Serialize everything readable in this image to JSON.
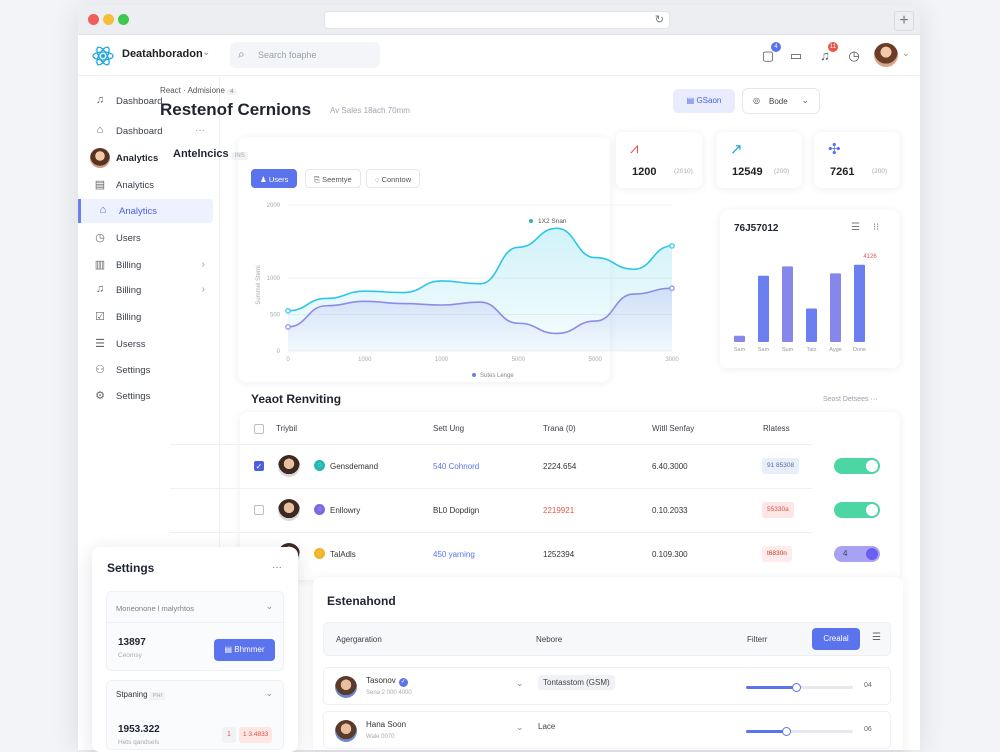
{
  "app": {
    "brand": "Deatahboradon",
    "search_placeholder": "Search foaphe",
    "notifications": {
      "tasks": "4",
      "alerts": "11"
    }
  },
  "sidebar": {
    "items": [
      {
        "label": "Dashboard",
        "icon": "bell-icon",
        "chevron": ""
      },
      {
        "label": "Dashboard",
        "icon": "home-icon",
        "chevron": "···"
      },
      {
        "label": "Analytics",
        "icon": "avatar",
        "chevron": ""
      },
      {
        "label": "Analytics",
        "icon": "window-icon",
        "chevron": ""
      },
      {
        "label": "Analytics",
        "icon": "home-icon",
        "chevron": ""
      },
      {
        "label": "Users",
        "icon": "clock-icon",
        "chevron": ""
      },
      {
        "label": "Billing",
        "icon": "document-icon",
        "chevron": "›"
      },
      {
        "label": "Billing",
        "icon": "bell-icon",
        "chevron": "›"
      },
      {
        "label": "Billing",
        "icon": "checklist-icon",
        "chevron": ""
      },
      {
        "label": "Userss",
        "icon": "list-icon",
        "chevron": ""
      },
      {
        "label": "Settings",
        "icon": "users-gear-icon",
        "chevron": ""
      },
      {
        "label": "Settings",
        "icon": "gear-icon",
        "chevron": ""
      }
    ],
    "active_index": 4
  },
  "header": {
    "breadcrumb": "React  ·  Admisione",
    "breadcrumb_badge": "4",
    "title": "Restenof Cernions",
    "subtitle": "Av  Sales  18ach 70mm",
    "primary_button": "GSaon",
    "select_button": "Bode"
  },
  "analytics": {
    "title": "Antelncics",
    "title_badge": "INS",
    "chips": [
      "Users",
      "Seemtye",
      "Conntow"
    ],
    "active_chip": 0
  },
  "chart_data": {
    "type": "area",
    "x_ticks": [
      "0",
      "1000",
      "1000",
      "5000",
      "5000",
      "3000"
    ],
    "y_ticks": [
      "0",
      "500",
      "1000",
      "2000"
    ],
    "ylabel": "Summel Sterni",
    "legend_top": "1X2 Snan",
    "legend_bottom": "Sutes Lenge",
    "ylim": [
      0,
      2000
    ],
    "series": [
      {
        "color": "#2cc6e6",
        "values": [
          550,
          720,
          820,
          800,
          960,
          920,
          1420,
          1680,
          1280,
          1120,
          1440
        ]
      },
      {
        "color": "#8f8be8",
        "values": [
          330,
          620,
          680,
          650,
          630,
          670,
          380,
          240,
          410,
          780,
          860
        ]
      }
    ]
  },
  "stats": [
    {
      "value": "1200",
      "sub": "(2010)",
      "icon": "trend-zigzag-icon",
      "color": "#e8564a"
    },
    {
      "value": "12549",
      "sub": "(200)",
      "icon": "trend-up-icon",
      "color": "#1aa8c8"
    },
    {
      "value": "7261",
      "sub": "(200)",
      "icon": "sparkle-icon",
      "color": "#5b73ec"
    }
  ],
  "bar_card": {
    "title": "76J57012",
    "peak_label": "4126",
    "bar_labels": [
      "Sam",
      "Sam",
      "Sum",
      "Tats",
      "Ayge",
      "Done"
    ],
    "values": [
      8,
      85,
      97,
      43,
      88,
      99
    ],
    "ylim": [
      0,
      100
    ]
  },
  "table": {
    "title": "Yeaot Renviting",
    "header_right": "Seost Detsees",
    "headers": [
      "Triybil",
      "Sett Ung",
      "Trana (0)",
      "Witll Senfay",
      "Rlatess"
    ],
    "rows": [
      {
        "checked": true,
        "name": "Gensdemand",
        "tag_color": "#26b8b0",
        "sett": "540 Cohnord",
        "sett_color": "#5b73ec",
        "trana": "2224.654",
        "trana_color": "#333",
        "witll": "6.40.3000",
        "status": "91 85308",
        "status_bg": "#e8eefb",
        "status_color": "#5b6a8f",
        "toggle": "green",
        "toggle_num": ""
      },
      {
        "checked": false,
        "name": "Enllowry",
        "tag_color": "#7a6ae0",
        "sett": "BL0 Dopdign",
        "sett_color": "#333",
        "trana": "2219921",
        "trana_color": "#e8564a",
        "witll": "0.10.2033",
        "status": "55330a",
        "status_bg": "#fde6e3",
        "status_color": "#d9534f",
        "toggle": "green",
        "toggle_num": ""
      },
      {
        "checked": false,
        "name": "TalAdls",
        "tag_color": "#f0b429",
        "sett": "450 yarning",
        "sett_color": "#5b73ec",
        "trana": "1252394",
        "trana_color": "#333",
        "witll": "0.109.300",
        "status": "t6830n",
        "status_bg": "#fdecea",
        "status_color": "#c0392b",
        "toggle": "purple",
        "toggle_num": "4"
      }
    ]
  },
  "settings": {
    "title": "Settings",
    "more": "···",
    "group1_label": "Moneonone l malyrhtos",
    "group1_value": "13897",
    "group1_sub": "Ceomsy",
    "group1_button": "Bhmmer",
    "group2_label": "Stpaning",
    "group2_badge": "PHI",
    "group2_value": "1953.322",
    "group2_sub": "Hets qandsels",
    "group2_mini": "1",
    "group2_tag": "1 3.4833"
  },
  "establishment": {
    "title": "Estenahond",
    "headers": [
      "Agergaration",
      "Nebore",
      "Filterr"
    ],
    "button": "Crealal",
    "rows": [
      {
        "name": "Tasonov",
        "sub": "Sena 2 000 4000",
        "value": "Tontasstom (GSM)",
        "pct": 0.47,
        "num": "04"
      },
      {
        "name": "Hana Soon",
        "sub": "Wale 0070",
        "value": "Lace",
        "pct": 0.37,
        "num": "06"
      }
    ]
  }
}
